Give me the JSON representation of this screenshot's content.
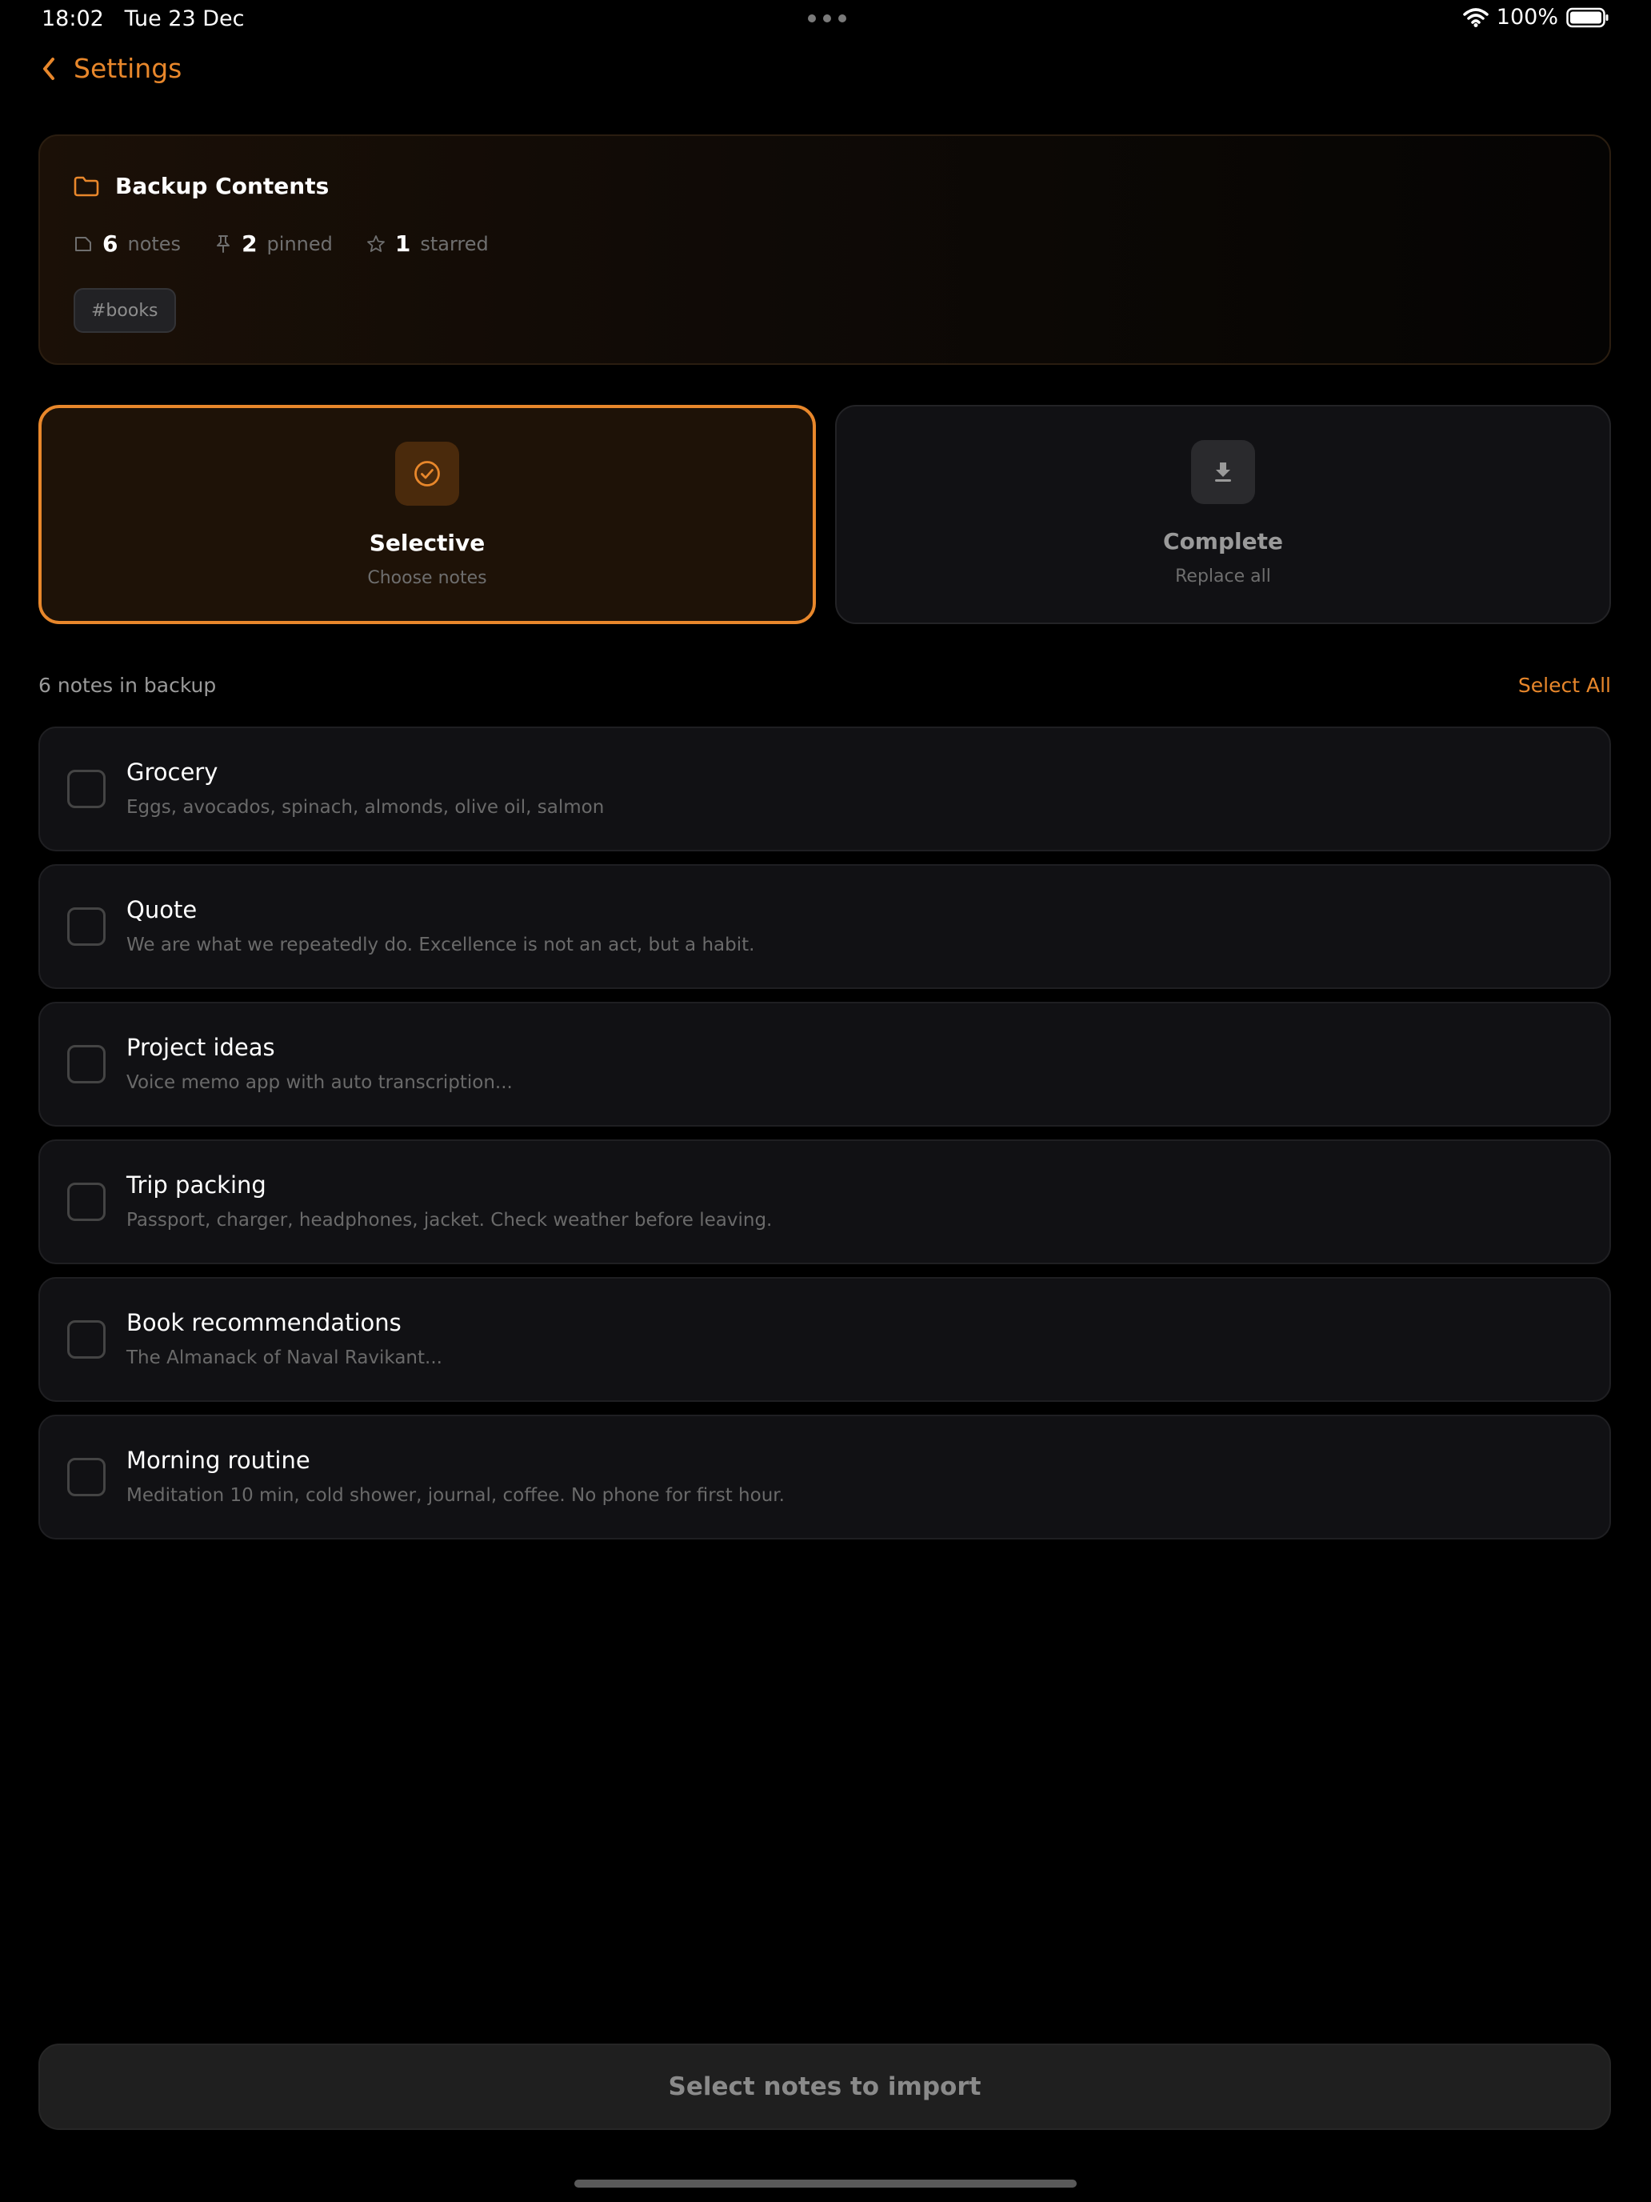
{
  "status_bar": {
    "time": "18:02",
    "date": "Tue 23 Dec",
    "battery": "100%"
  },
  "nav": {
    "back_label": "Settings"
  },
  "summary": {
    "title": "Backup Contents",
    "notes_count": "6",
    "notes_label": "notes",
    "pinned_count": "2",
    "pinned_label": "pinned",
    "starred_count": "1",
    "starred_label": "starred",
    "tags": [
      "#books"
    ]
  },
  "modes": {
    "selective": {
      "title": "Selective",
      "subtitle": "Choose notes",
      "selected": true
    },
    "complete": {
      "title": "Complete",
      "subtitle": "Replace all",
      "selected": false
    }
  },
  "list": {
    "count_label": "6 notes in backup",
    "select_all_label": "Select All",
    "notes": [
      {
        "title": "Grocery",
        "preview": "Eggs, avocados, spinach, almonds, olive oil, salmon",
        "checked": false
      },
      {
        "title": "Quote",
        "preview": "We are what we repeatedly do. Excellence is not an act, but a habit.",
        "checked": false
      },
      {
        "title": "Project ideas",
        "preview": "Voice memo app with auto transcription...",
        "checked": false
      },
      {
        "title": "Trip packing",
        "preview": "Passport, charger, headphones, jacket. Check weather before leaving.",
        "checked": false
      },
      {
        "title": "Book recommendations",
        "preview": "The Almanack of Naval Ravikant...",
        "checked": false
      },
      {
        "title": "Morning routine",
        "preview": "Meditation 10 min, cold shower, journal, coffee. No phone for first hour.",
        "checked": false
      }
    ]
  },
  "import_button": {
    "label": "Select notes to import"
  },
  "colors": {
    "accent": "#e8872b",
    "background": "#000000",
    "card": "#111114"
  }
}
